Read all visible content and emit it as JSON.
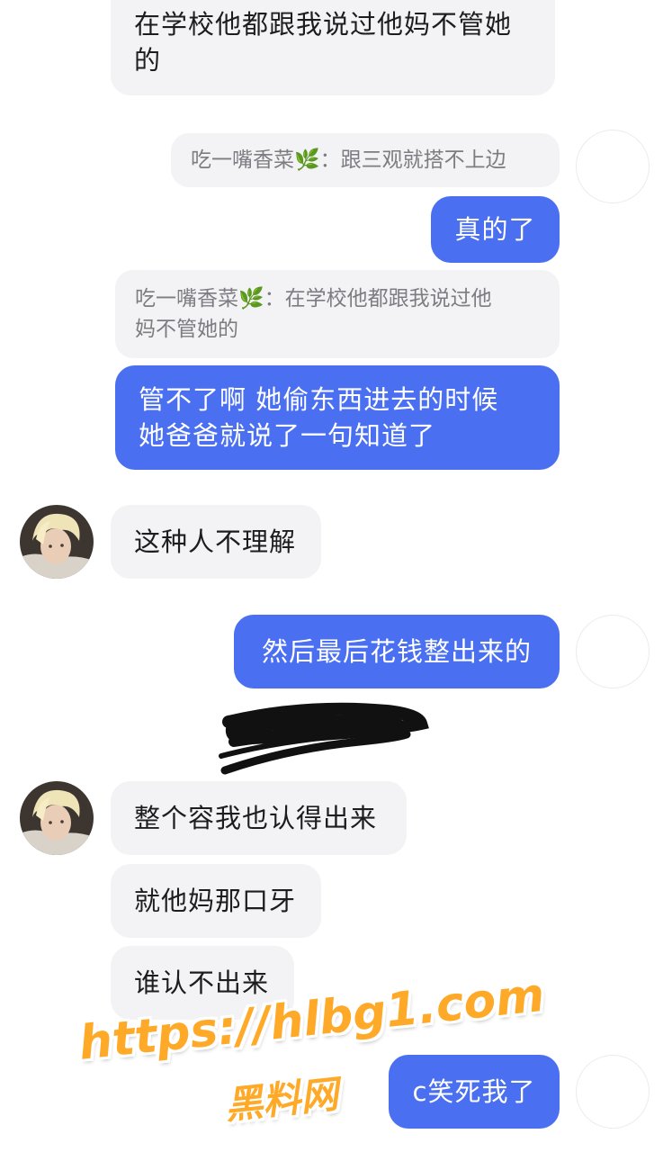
{
  "messages": [
    {
      "text_line1": "在学校他都跟我说过他妈不管她",
      "text_line2": "的"
    },
    {
      "quote": "吃一嘴香菜🌿：跟三观就搭不上边"
    },
    {
      "text": "真的了"
    },
    {
      "quote_line1": "吃一嘴香菜🌿：在学校他都跟我说过他",
      "quote_line2": "妈不管她的"
    },
    {
      "text_line1": "管不了啊 她偷东西进去的时候",
      "text_line2": "她爸爸就说了一句知道了"
    },
    {
      "text": "这种人不理解"
    },
    {
      "text": "然后最后花钱整出来的"
    },
    {
      "text": "整个容我也认得出来"
    },
    {
      "text": "就他妈那口牙"
    },
    {
      "text": "谁认不出来"
    },
    {
      "text": "c笑死我了"
    }
  ],
  "watermark": {
    "url": "https://hlbg1.com",
    "name": "黑料网"
  },
  "colors": {
    "incoming_bubble": "#f3f3f5",
    "outgoing_bubble": "#4a6ff0",
    "watermark": "#ffa928"
  }
}
